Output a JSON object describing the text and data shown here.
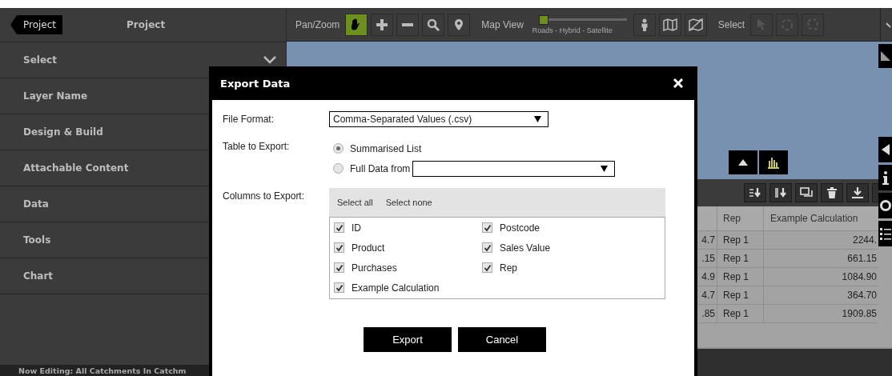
{
  "sidebar": {
    "back_button": "Project",
    "title": "Project",
    "items": [
      {
        "label": "Select",
        "kind": "dropdown"
      },
      {
        "label": "Layer Name",
        "kind": "link"
      },
      {
        "label": "Design & Build",
        "kind": "link"
      },
      {
        "label": "Attachable Content",
        "kind": "link"
      },
      {
        "label": "Data",
        "kind": "link"
      },
      {
        "label": "Tools",
        "kind": "link"
      },
      {
        "label": "Chart",
        "kind": "link"
      }
    ],
    "footer": "Now Editing: All Catchments In Catchm"
  },
  "toolbar": {
    "pan_zoom": {
      "label": "Pan/Zoom",
      "tools": [
        {
          "selected": true
        },
        {
          "selected": false
        },
        {
          "selected": false
        },
        {
          "selected": false
        },
        {
          "selected": false
        }
      ]
    },
    "map_view": {
      "label": "Map View",
      "level": 0,
      "slider_label": "Roads - Hybrid - Satellite"
    },
    "select": {
      "label": "Select",
      "tools": [
        {
          "disabled": true
        },
        {
          "disabled": true
        },
        {
          "disabled": true
        }
      ]
    }
  },
  "table": {
    "columns": [
      "Rep",
      "Example Calculation"
    ],
    "rows": [
      {
        "column_1": "4.7",
        "rep": "Rep 1",
        "example_calculation": "2244."
      },
      {
        "column_1": ".15",
        "rep": "Rep 1",
        "example_calculation": "661.15"
      },
      {
        "column_1": "4.9",
        "rep": "Rep 1",
        "example_calculation": "1084.90"
      },
      {
        "column_1": "4.7",
        "rep": "Rep 1",
        "example_calculation": "364.70"
      },
      {
        "column_1": ".85",
        "rep": "Rep 1",
        "example_calculation": "1909.85"
      }
    ]
  },
  "dialog": {
    "title": "Export Data",
    "file_format": {
      "label": "File Format:",
      "value": "Comma-Separated Values (.csv)"
    },
    "table_to_export": {
      "label": "Table to Export:",
      "options": [
        {
          "label": "Summarised List",
          "selected": true,
          "kind": "plain"
        },
        {
          "label": "Full Data from",
          "selected": false,
          "kind": "select"
        }
      ]
    },
    "columns_to_export": {
      "label": "Columns to Export:",
      "links": [
        "Select all",
        "Select none"
      ],
      "columns": [
        {
          "label": "ID",
          "checked": true
        },
        {
          "label": "Postcode",
          "checked": true
        },
        {
          "label": "Product",
          "checked": true
        },
        {
          "label": "Sales Value",
          "checked": true
        },
        {
          "label": "Purchases",
          "checked": true
        },
        {
          "label": "Rep",
          "checked": true
        },
        {
          "label": "Example Calculation",
          "checked": true
        }
      ]
    },
    "buttons": [
      "Export",
      "Cancel"
    ]
  }
}
